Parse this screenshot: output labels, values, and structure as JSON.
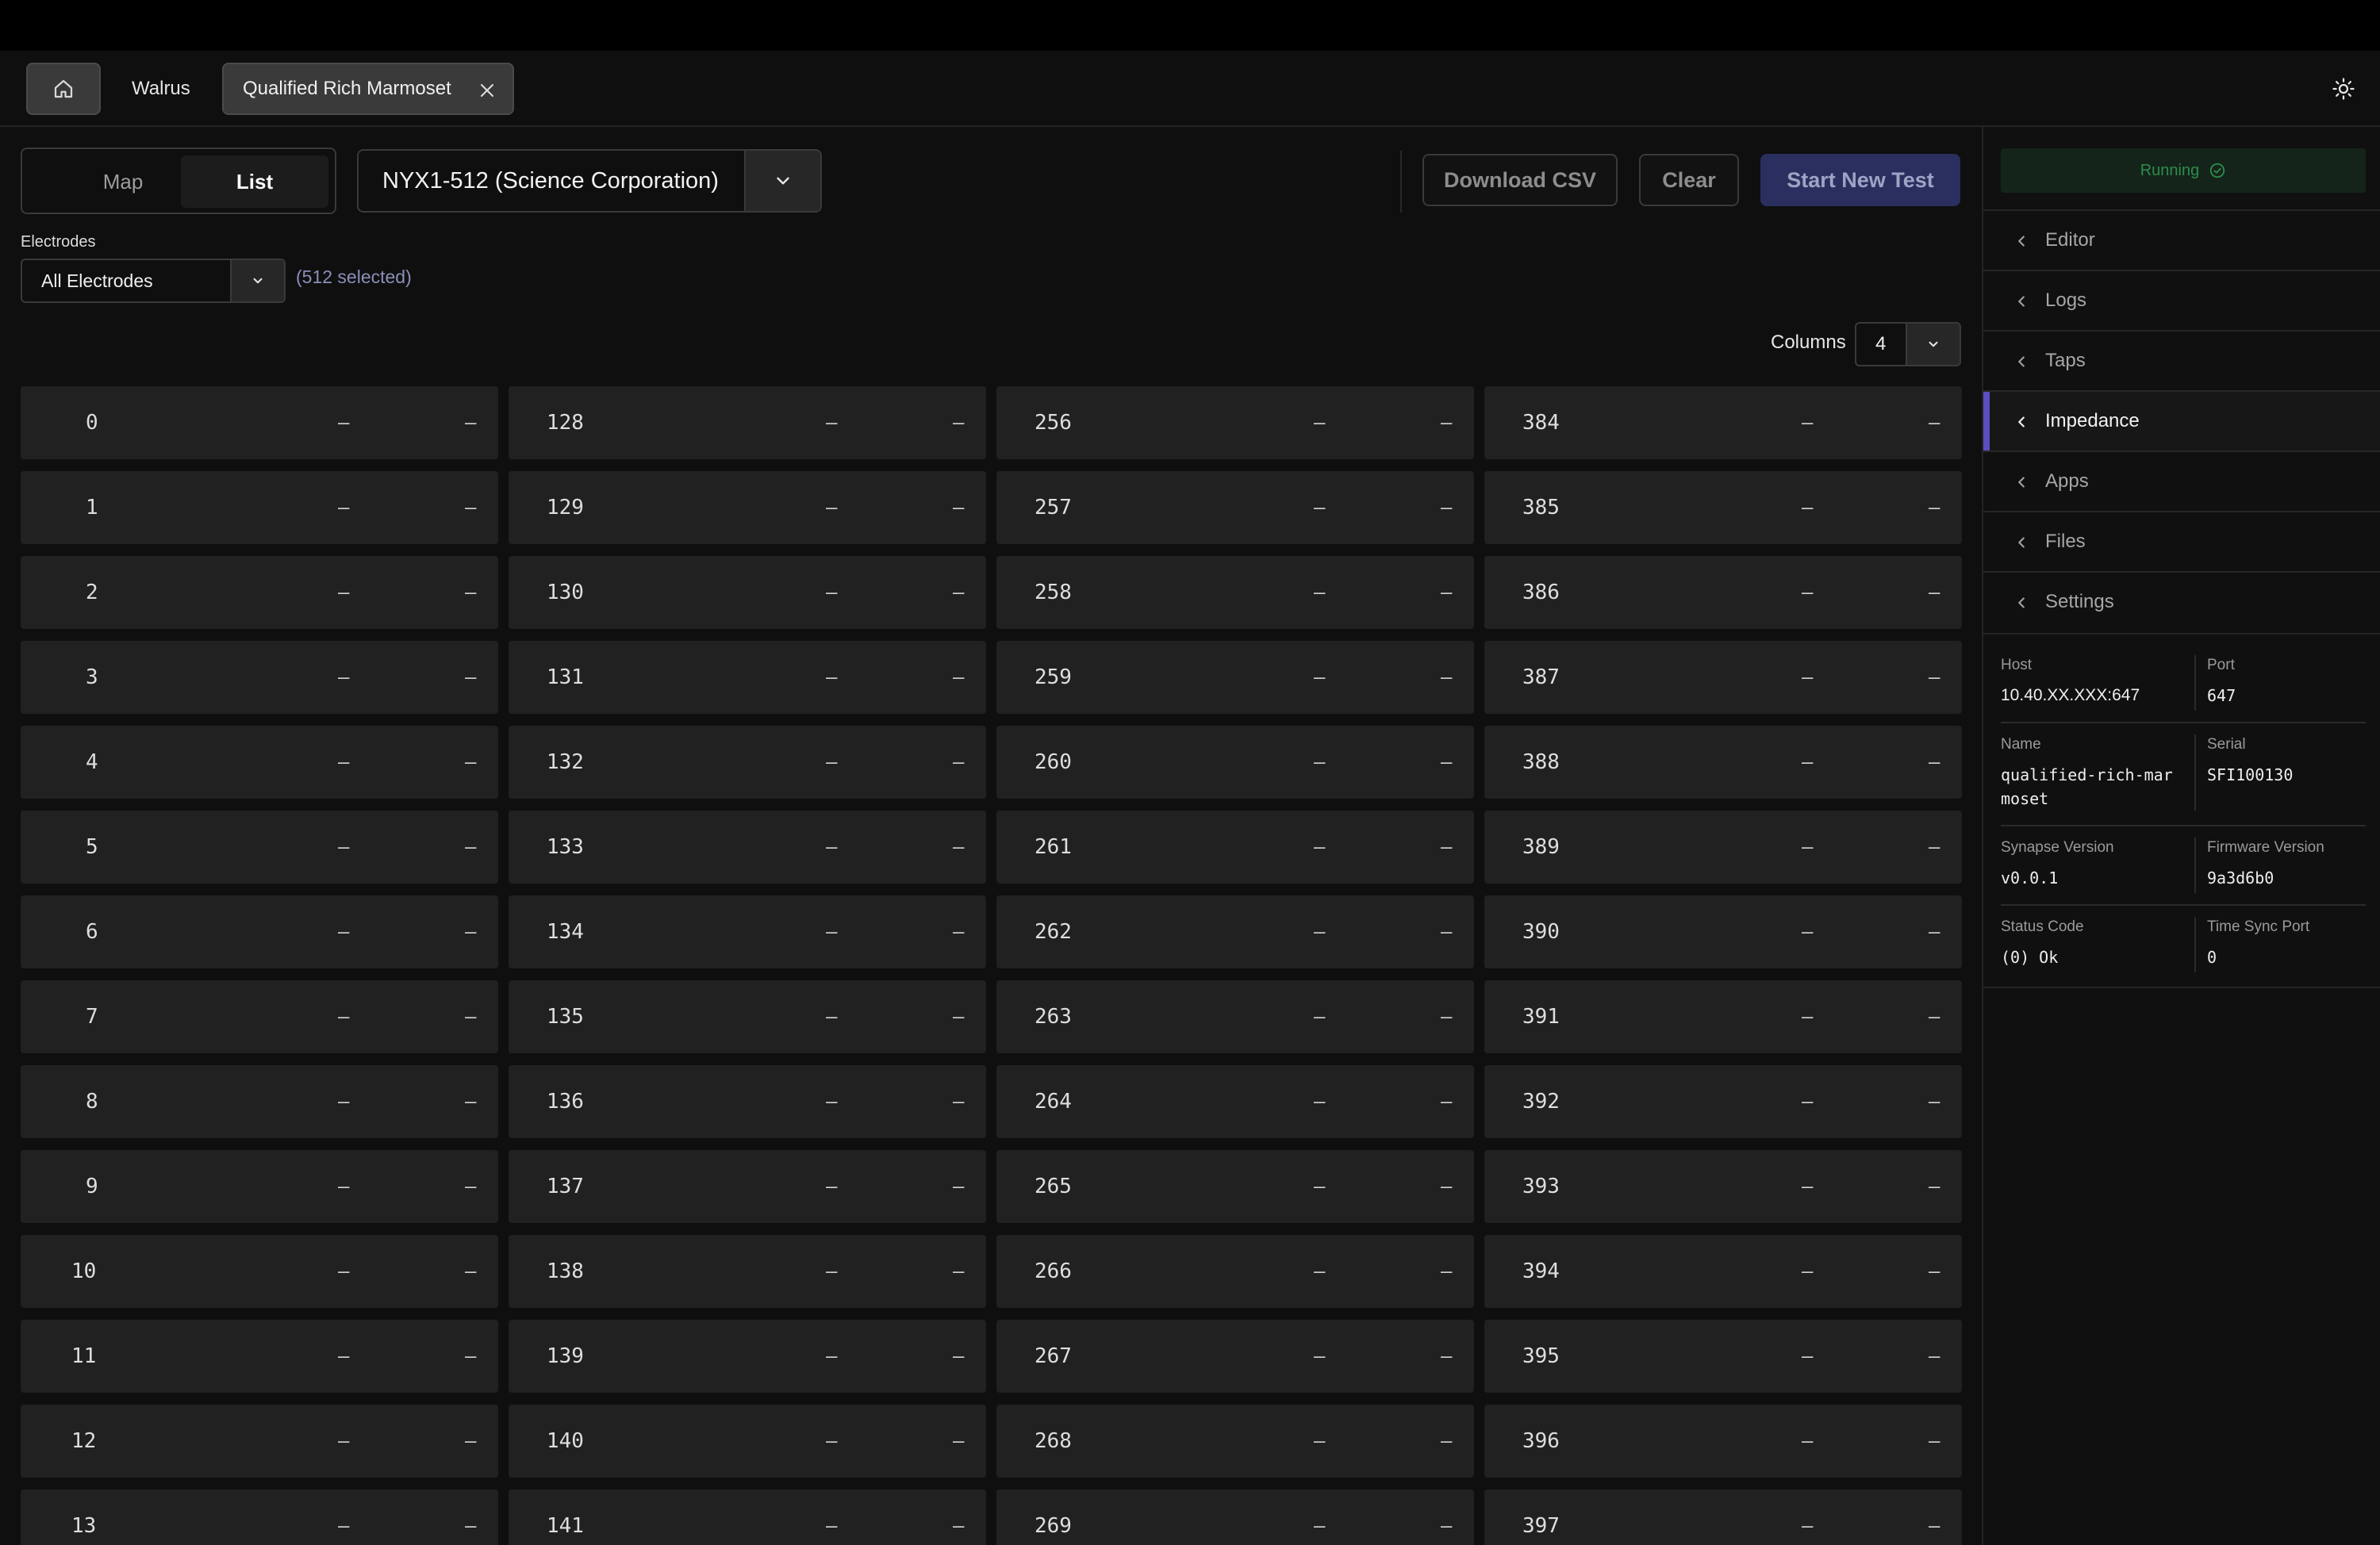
{
  "tabs": {
    "workspace_label": "Walrus",
    "active_label": "Qualified Rich Marmoset"
  },
  "toolbar": {
    "view_map": "Map",
    "view_list": "List",
    "device": "NYX1-512 (Science Corporation)",
    "download_csv": "Download CSV",
    "clear": "Clear",
    "start_test": "Start New Test"
  },
  "electrodes": {
    "label": "Electrodes",
    "selected_value": "All Electrodes",
    "count_text": "(512 selected)"
  },
  "columns": {
    "label": "Columns",
    "value": "4"
  },
  "grid": {
    "columns": [
      [
        {
          "id": "0",
          "a": "–",
          "b": "–"
        },
        {
          "id": "1",
          "a": "–",
          "b": "–"
        },
        {
          "id": "2",
          "a": "–",
          "b": "–"
        },
        {
          "id": "3",
          "a": "–",
          "b": "–"
        },
        {
          "id": "4",
          "a": "–",
          "b": "–"
        },
        {
          "id": "5",
          "a": "–",
          "b": "–"
        },
        {
          "id": "6",
          "a": "–",
          "b": "–"
        },
        {
          "id": "7",
          "a": "–",
          "b": "–"
        },
        {
          "id": "8",
          "a": "–",
          "b": "–"
        },
        {
          "id": "9",
          "a": "–",
          "b": "–"
        },
        {
          "id": "10",
          "a": "–",
          "b": "–"
        },
        {
          "id": "11",
          "a": "–",
          "b": "–"
        },
        {
          "id": "12",
          "a": "–",
          "b": "–"
        },
        {
          "id": "13",
          "a": "–",
          "b": "–"
        }
      ],
      [
        {
          "id": "128",
          "a": "–",
          "b": "–"
        },
        {
          "id": "129",
          "a": "–",
          "b": "–"
        },
        {
          "id": "130",
          "a": "–",
          "b": "–"
        },
        {
          "id": "131",
          "a": "–",
          "b": "–"
        },
        {
          "id": "132",
          "a": "–",
          "b": "–"
        },
        {
          "id": "133",
          "a": "–",
          "b": "–"
        },
        {
          "id": "134",
          "a": "–",
          "b": "–"
        },
        {
          "id": "135",
          "a": "–",
          "b": "–"
        },
        {
          "id": "136",
          "a": "–",
          "b": "–"
        },
        {
          "id": "137",
          "a": "–",
          "b": "–"
        },
        {
          "id": "138",
          "a": "–",
          "b": "–"
        },
        {
          "id": "139",
          "a": "–",
          "b": "–"
        },
        {
          "id": "140",
          "a": "–",
          "b": "–"
        },
        {
          "id": "141",
          "a": "–",
          "b": "–"
        }
      ],
      [
        {
          "id": "256",
          "a": "–",
          "b": "–"
        },
        {
          "id": "257",
          "a": "–",
          "b": "–"
        },
        {
          "id": "258",
          "a": "–",
          "b": "–"
        },
        {
          "id": "259",
          "a": "–",
          "b": "–"
        },
        {
          "id": "260",
          "a": "–",
          "b": "–"
        },
        {
          "id": "261",
          "a": "–",
          "b": "–"
        },
        {
          "id": "262",
          "a": "–",
          "b": "–"
        },
        {
          "id": "263",
          "a": "–",
          "b": "–"
        },
        {
          "id": "264",
          "a": "–",
          "b": "–"
        },
        {
          "id": "265",
          "a": "–",
          "b": "–"
        },
        {
          "id": "266",
          "a": "–",
          "b": "–"
        },
        {
          "id": "267",
          "a": "–",
          "b": "–"
        },
        {
          "id": "268",
          "a": "–",
          "b": "–"
        },
        {
          "id": "269",
          "a": "–",
          "b": "–"
        }
      ],
      [
        {
          "id": "384",
          "a": "–",
          "b": "–"
        },
        {
          "id": "385",
          "a": "–",
          "b": "–"
        },
        {
          "id": "386",
          "a": "–",
          "b": "–"
        },
        {
          "id": "387",
          "a": "–",
          "b": "–"
        },
        {
          "id": "388",
          "a": "–",
          "b": "–"
        },
        {
          "id": "389",
          "a": "–",
          "b": "–"
        },
        {
          "id": "390",
          "a": "–",
          "b": "–"
        },
        {
          "id": "391",
          "a": "–",
          "b": "–"
        },
        {
          "id": "392",
          "a": "–",
          "b": "–"
        },
        {
          "id": "393",
          "a": "–",
          "b": "–"
        },
        {
          "id": "394",
          "a": "–",
          "b": "–"
        },
        {
          "id": "395",
          "a": "–",
          "b": "–"
        },
        {
          "id": "396",
          "a": "–",
          "b": "–"
        },
        {
          "id": "397",
          "a": "–",
          "b": "–"
        }
      ]
    ]
  },
  "panel": {
    "status": "Running",
    "nav": [
      "Editor",
      "Logs",
      "Taps",
      "Impedance",
      "Apps",
      "Files",
      "Settings"
    ],
    "active_nav": "Impedance",
    "info": {
      "host_label": "Host",
      "host": "10.40.XX.XXX:647",
      "port_label": "Port",
      "port": "647",
      "name_label": "Name",
      "name": "qualified-rich-marmoset",
      "serial_label": "Serial",
      "serial": "SFI100130",
      "synapse_label": "Synapse Version",
      "synapse": "v0.0.1",
      "firmware_label": "Firmware Version",
      "firmware": "9a3d6b0",
      "status_code_label": "Status Code",
      "status_code": "(0) Ok",
      "timesync_label": "Time Sync Port",
      "timesync": "0"
    }
  },
  "colors": {
    "accent": "#5a4fc0",
    "start_button": "#2a2f60",
    "running_green": "#2f8c4c"
  },
  "icons": {
    "home": "home-icon",
    "close": "close-icon",
    "theme": "sun-icon",
    "dropdown": "chevron-down-icon",
    "nav": "chevron-left-icon",
    "status": "check-circle-icon"
  }
}
